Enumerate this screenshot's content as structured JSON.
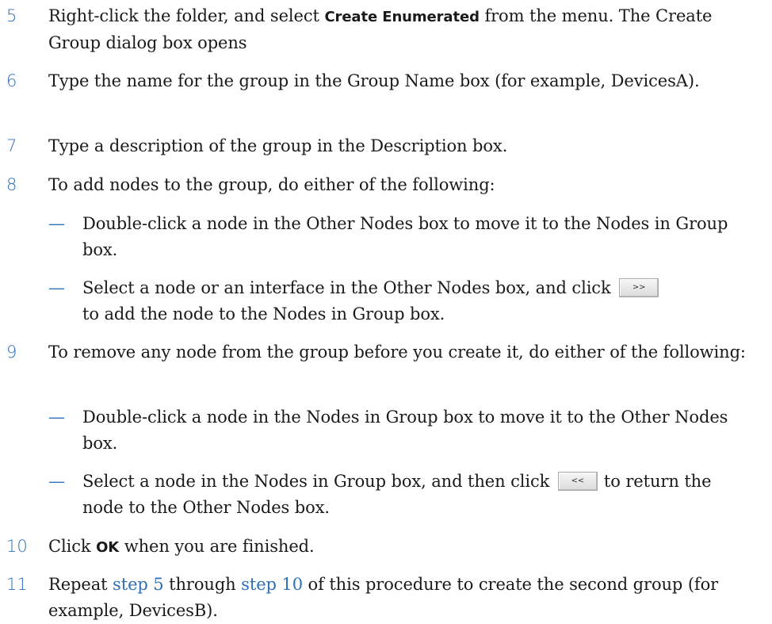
{
  "steps": [
    {
      "num": "5",
      "a": "Right-click the folder, and select ",
      "ui": "Create Enumerated",
      "b": " from the menu. The Create Group dialog box opens"
    },
    {
      "num": "6",
      "text": "Type the name for the group in the Group Name box (for example, DevicesA)."
    },
    {
      "num": "7",
      "text": "Type a description of the group in the Description box."
    },
    {
      "num": "8",
      "text": "To add nodes to the group, do either of the following:",
      "subs": [
        {
          "dash": "—",
          "text": "Double-click a node in the Other Nodes box to move it to the Nodes in Group box."
        },
        {
          "dash": "—",
          "a": "Select a node or an interface in the Other Nodes box, and click",
          "button": ">>",
          "b": "to add the node to the Nodes in Group box."
        }
      ]
    },
    {
      "num": "9",
      "text": "To remove any node from the group before you create it, do either of the following:",
      "subs": [
        {
          "dash": "—",
          "text": "Double-click a node in the Nodes in Group box to move it to the Other Nodes box."
        },
        {
          "dash": "—",
          "a": "Select a node in the Nodes in Group box, and then click",
          "button": "<<",
          "b": "to return the node to the Other Nodes box."
        }
      ]
    },
    {
      "num": "10",
      "a": "Click ",
      "ui": "OK",
      "b": " when you are finished."
    },
    {
      "num": "11",
      "a": "Repeat ",
      "link1": "step 5",
      "mid": " through ",
      "link2": "step 10",
      "b": " of this procedure to create the second group (for example, DevicesB)."
    }
  ]
}
